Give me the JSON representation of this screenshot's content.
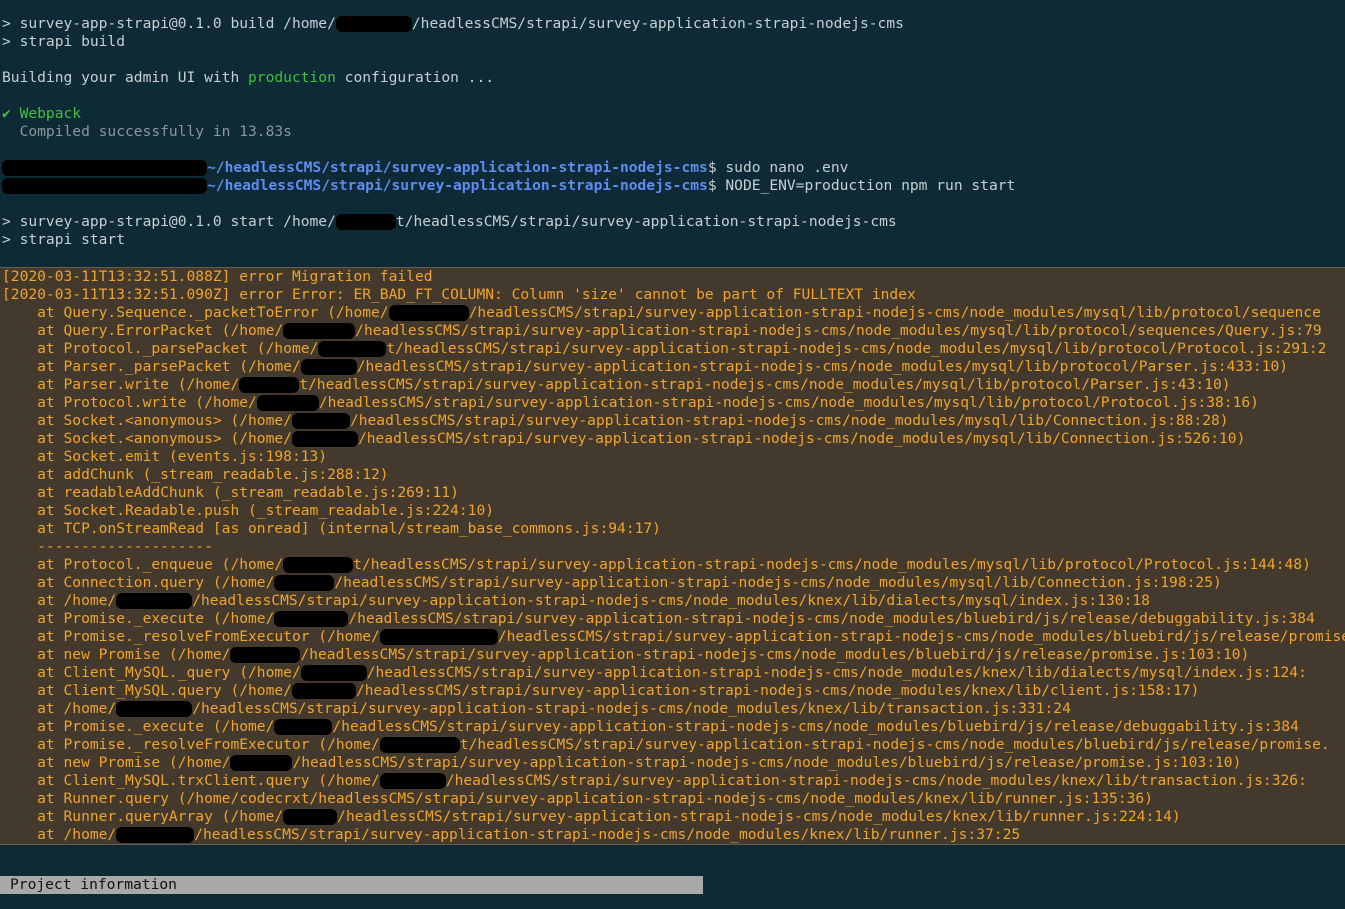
{
  "colors": {
    "background": "#0e2a36",
    "error_bg": "#433a2d",
    "error_text": "#f1a32a",
    "green": "#3fc23f",
    "prompt_path": "#5c8df0"
  },
  "build": {
    "cmd1_pre": "> survey-app-strapi@0.1.0 build /home/",
    "cmd1_post": "/headlessCMS/strapi/survey-application-strapi-nodejs-cms",
    "cmd2": "> strapi build",
    "building_pre": "Building your admin UI with ",
    "building_env": "production",
    "building_post": " configuration ...",
    "webpack": "✔ Webpack",
    "compiled": "  Compiled successfully in 13.83s"
  },
  "prompts": [
    {
      "path": "~/headlessCMS/strapi/survey-application-strapi-nodejs-cms",
      "cmd": "$ sudo nano .env"
    },
    {
      "path": "~/headlessCMS/strapi/survey-application-strapi-nodejs-cms",
      "cmd": "$ NODE_ENV=production npm run start"
    }
  ],
  "start": {
    "cmd1_pre": "> survey-app-strapi@0.1.0 start /home/",
    "cmd1_post": "t/headlessCMS/strapi/survey-application-strapi-nodejs-cms",
    "cmd2": "> strapi start"
  },
  "errors": [
    "[2020-03-11T13:32:51.088Z] error Migration failed",
    "[2020-03-11T13:32:51.090Z] error Error: ER_BAD_FT_COLUMN: Column 'size' cannot be part of FULLTEXT index"
  ],
  "stack": [
    {
      "pre": "    at Query.Sequence._packetToError (/home/",
      "post": "/headlessCMS/strapi/survey-application-strapi-nodejs-cms/node_modules/mysql/lib/protocol/sequence"
    },
    {
      "pre": "    at Query.ErrorPacket (/home/",
      "post": "/headlessCMS/strapi/survey-application-strapi-nodejs-cms/node_modules/mysql/lib/protocol/sequences/Query.js:79"
    },
    {
      "pre": "    at Protocol._parsePacket (/home/",
      "post": "t/headlessCMS/strapi/survey-application-strapi-nodejs-cms/node_modules/mysql/lib/protocol/Protocol.js:291:2"
    },
    {
      "pre": "    at Parser._parsePacket (/home/",
      "post": "/headlessCMS/strapi/survey-application-strapi-nodejs-cms/node_modules/mysql/lib/protocol/Parser.js:433:10)"
    },
    {
      "pre": "    at Parser.write (/home/",
      "post": "t/headlessCMS/strapi/survey-application-strapi-nodejs-cms/node_modules/mysql/lib/protocol/Parser.js:43:10)"
    },
    {
      "pre": "    at Protocol.write (/home/",
      "post": "/headlessCMS/strapi/survey-application-strapi-nodejs-cms/node_modules/mysql/lib/protocol/Protocol.js:38:16)"
    },
    {
      "pre": "    at Socket.<anonymous> (/home/",
      "post": "/headlessCMS/strapi/survey-application-strapi-nodejs-cms/node_modules/mysql/lib/Connection.js:88:28)"
    },
    {
      "pre": "    at Socket.<anonymous> (/home/",
      "post": "/headlessCMS/strapi/survey-application-strapi-nodejs-cms/node_modules/mysql/lib/Connection.js:526:10)"
    },
    {
      "pre": "    at Socket.emit (events.js:198:13)",
      "post": ""
    },
    {
      "pre": "    at addChunk (_stream_readable.js:288:12)",
      "post": ""
    },
    {
      "pre": "    at readableAddChunk (_stream_readable.js:269:11)",
      "post": ""
    },
    {
      "pre": "    at Socket.Readable.push (_stream_readable.js:224:10)",
      "post": ""
    },
    {
      "pre": "    at TCP.onStreamRead [as onread] (internal/stream_base_commons.js:94:17)",
      "post": ""
    },
    {
      "pre": "    --------------------",
      "post": ""
    },
    {
      "pre": "    at Protocol._enqueue (/home/",
      "post": "t/headlessCMS/strapi/survey-application-strapi-nodejs-cms/node_modules/mysql/lib/protocol/Protocol.js:144:48)"
    },
    {
      "pre": "    at Connection.query (/home/",
      "post": "/headlessCMS/strapi/survey-application-strapi-nodejs-cms/node_modules/mysql/lib/Connection.js:198:25)"
    },
    {
      "pre": "    at /home/",
      "post": "/headlessCMS/strapi/survey-application-strapi-nodejs-cms/node_modules/knex/lib/dialects/mysql/index.js:130:18"
    },
    {
      "pre": "    at Promise._execute (/home/",
      "post": "/headlessCMS/strapi/survey-application-strapi-nodejs-cms/node_modules/bluebird/js/release/debuggability.js:384"
    },
    {
      "pre": "    at Promise._resolveFromExecutor (/home/",
      "post": "/headlessCMS/strapi/survey-application-strapi-nodejs-cms/node_modules/bluebird/js/release/promise."
    },
    {
      "pre": "    at new Promise (/home/",
      "post": "/headlessCMS/strapi/survey-application-strapi-nodejs-cms/node_modules/bluebird/js/release/promise.js:103:10)"
    },
    {
      "pre": "    at Client_MySQL._query (/home/",
      "post": "/headlessCMS/strapi/survey-application-strapi-nodejs-cms/node_modules/knex/lib/dialects/mysql/index.js:124:"
    },
    {
      "pre": "    at Client_MySQL.query (/home/",
      "post": "/headlessCMS/strapi/survey-application-strapi-nodejs-cms/node_modules/knex/lib/client.js:158:17)"
    },
    {
      "pre": "    at /home/",
      "post": "/headlessCMS/strapi/survey-application-strapi-nodejs-cms/node_modules/knex/lib/transaction.js:331:24"
    },
    {
      "pre": "    at Promise._execute (/home/",
      "post": "/headlessCMS/strapi/survey-application-strapi-nodejs-cms/node_modules/bluebird/js/release/debuggability.js:384"
    },
    {
      "pre": "    at Promise._resolveFromExecutor (/home/",
      "post": "t/headlessCMS/strapi/survey-application-strapi-nodejs-cms/node_modules/bluebird/js/release/promise."
    },
    {
      "pre": "    at new Promise (/home/",
      "post": "/headlessCMS/strapi/survey-application-strapi-nodejs-cms/node_modules/bluebird/js/release/promise.js:103:10)"
    },
    {
      "pre": "    at Client_MySQL.trxClient.query (/home/",
      "post": "/headlessCMS/strapi/survey-application-strapi-nodejs-cms/node_modules/knex/lib/transaction.js:326:"
    },
    {
      "pre": "    at Runner.query (/home/codecrxt/headlessCMS/strapi/survey-application-strapi-nodejs-cms/node_modules/knex/lib/runner.js:135:36)",
      "post": ""
    },
    {
      "pre": "    at Runner.queryArray (/home/",
      "post": "/headlessCMS/strapi/survey-application-strapi-nodejs-cms/node_modules/knex/lib/runner.js:224:14)"
    },
    {
      "pre": "    at /home/",
      "post": "/headlessCMS/strapi/survey-application-strapi-nodejs-cms/node_modules/knex/lib/runner.js:37:25"
    }
  ],
  "statusbar": {
    "label": "Project information"
  }
}
